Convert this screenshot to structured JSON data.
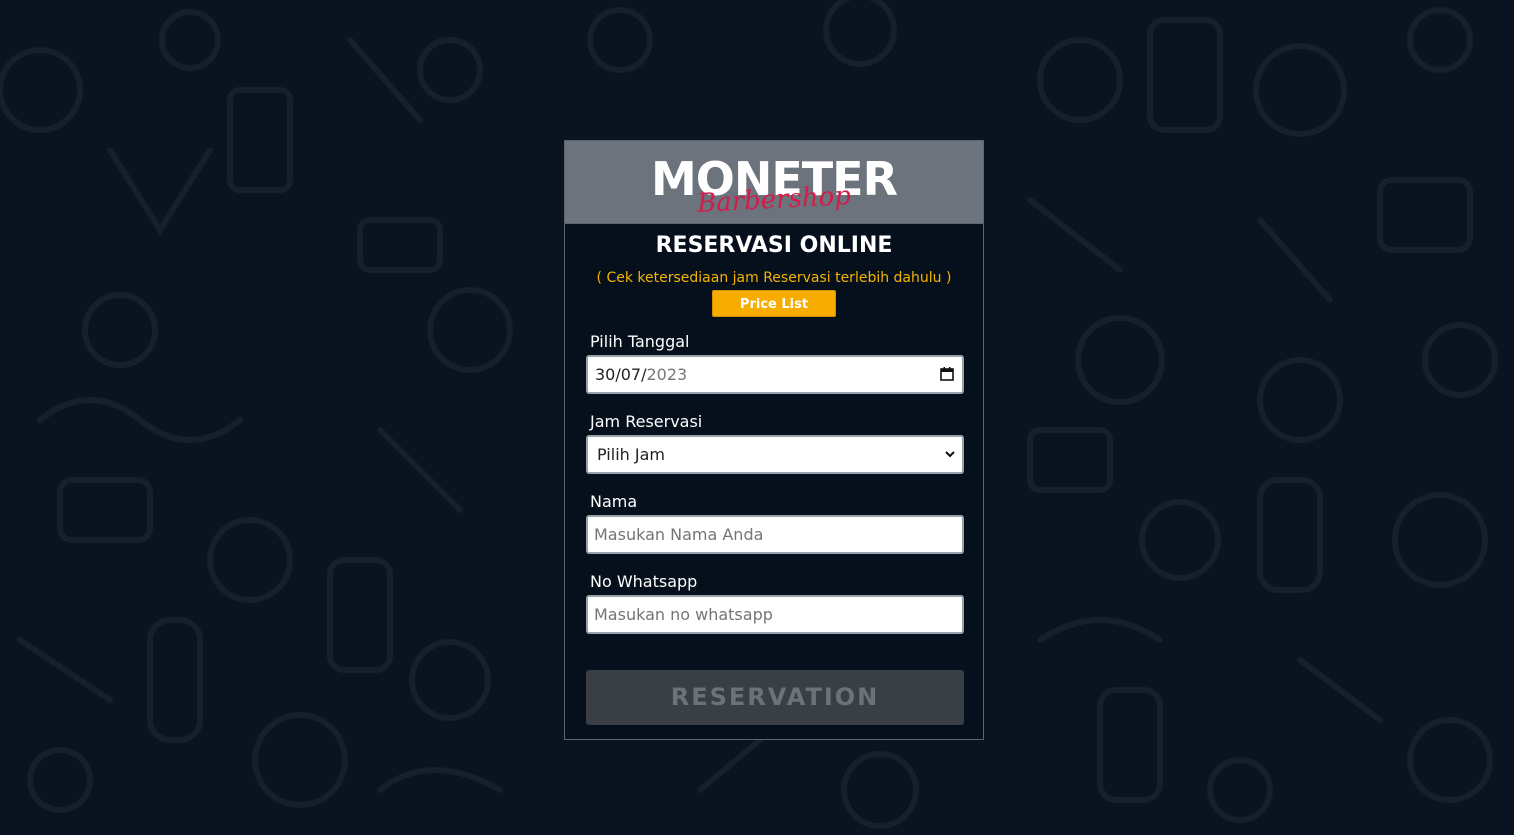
{
  "brand": {
    "name": "MONETER",
    "tagline": "Barbershop"
  },
  "form": {
    "title": "RESERVASI ONLINE",
    "subtitle": "( Cek ketersediaan jam Reservasi terlebih dahulu )",
    "price_list_label": "Price List",
    "date": {
      "label": "Pilih Tanggal",
      "day_month": "30/07/",
      "year": "2023"
    },
    "time": {
      "label": "Jam Reservasi",
      "selected": "Pilih Jam"
    },
    "name": {
      "label": "Nama",
      "placeholder": "Masukan Nama Anda"
    },
    "whatsapp": {
      "label": "No Whatsapp",
      "placeholder": "Masukan no whatsapp"
    },
    "submit_label": "RESERVATION"
  },
  "colors": {
    "background": "#0a1420",
    "header": "#6c737c",
    "accent": "#f8ac00",
    "brand_red": "#d21c4a",
    "button_disabled": "#3a3f46"
  },
  "icons": {
    "date": "calendar-icon",
    "select": "chevron-down-icon"
  }
}
